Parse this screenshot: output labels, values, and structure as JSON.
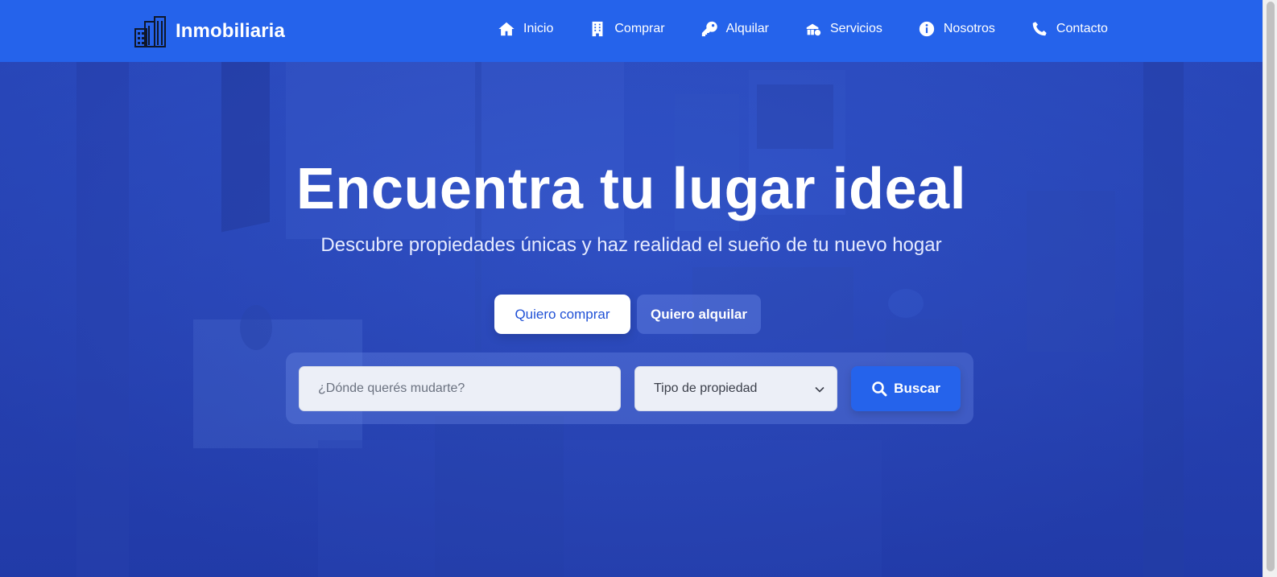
{
  "header": {
    "brand_name": "Inmobiliaria",
    "nav": [
      {
        "label": "Inicio",
        "icon": "home-icon"
      },
      {
        "label": "Comprar",
        "icon": "building-icon"
      },
      {
        "label": "Alquilar",
        "icon": "key-icon"
      },
      {
        "label": "Servicios",
        "icon": "services-icon"
      },
      {
        "label": "Nosotros",
        "icon": "info-icon"
      },
      {
        "label": "Contacto",
        "icon": "phone-icon"
      }
    ]
  },
  "hero": {
    "title": "Encuentra tu lugar ideal",
    "subtitle": "Descubre propiedades únicas y haz realidad el sueño de tu nuevo hogar",
    "tabs": [
      {
        "label": "Quiero comprar",
        "active": true
      },
      {
        "label": "Quiero alquilar",
        "active": false
      }
    ],
    "search": {
      "location_placeholder": "¿Dónde querés mudarte?",
      "location_value": "",
      "property_type_selected": "Tipo de propiedad",
      "button_label": "Buscar"
    }
  },
  "colors": {
    "primary": "#2563eb",
    "hero_overlay": "#2946b7",
    "white": "#ffffff"
  }
}
